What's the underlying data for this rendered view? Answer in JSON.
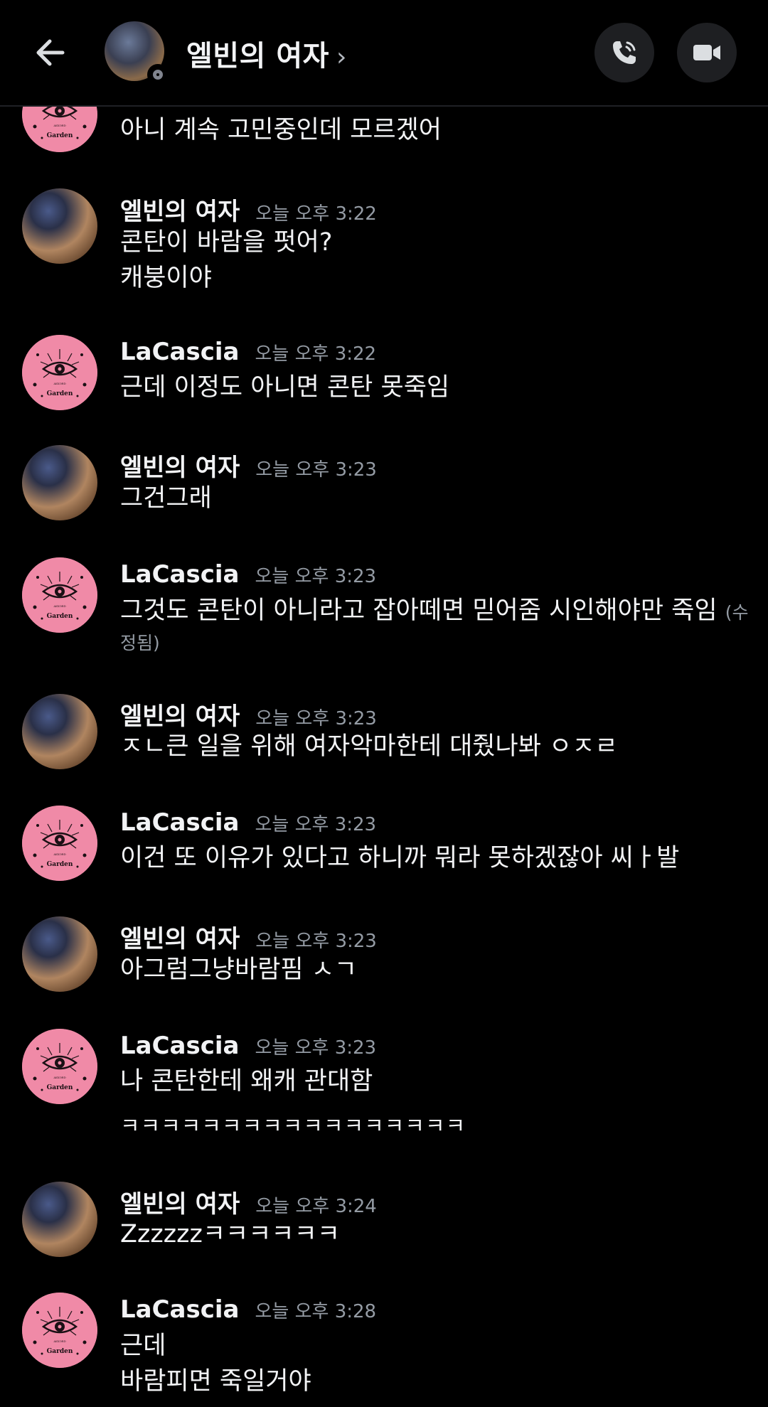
{
  "header": {
    "title": "엘빈의 여자",
    "chevron": "›",
    "back_icon": "arrow-left-icon",
    "call_icon": "phone-icon",
    "video_icon": "video-camera-icon"
  },
  "messages": [
    {
      "lines": [
        "아니 계속 고민중인데 모르겠어"
      ]
    },
    {
      "author": "엘빈의 여자",
      "time": "오늘 오후 3:22",
      "lines": [
        "콘탄이 바람을 펏어?",
        "캐붕이야"
      ]
    },
    {
      "author": "LaCascia",
      "time": "오늘 오후 3:22",
      "lines": [
        "근데 이정도 아니면 콘탄 못죽임"
      ]
    },
    {
      "author": "엘빈의 여자",
      "time": "오늘 오후 3:23",
      "lines": [
        "그건그래"
      ]
    },
    {
      "author": "LaCascia",
      "time": "오늘 오후 3:23",
      "lines": [
        "그것도 콘탄이 아니라고 잡아떼면 믿어줌 시인해야만 죽임",
        "정됨)"
      ],
      "edited": "(수"
    },
    {
      "author": "엘빈의 여자",
      "time": "오늘 오후 3:23",
      "lines": [
        "ㅈㄴ큰 일을 위해 여자악마한테 대줬나봐 ㅇㅈㄹ"
      ]
    },
    {
      "author": "LaCascia",
      "time": "오늘 오후 3:23",
      "lines": [
        "이건 또 이유가 있다고 하니까 뭐라 못하겠잖아 씨ㅏ발"
      ]
    },
    {
      "author": "엘빈의 여자",
      "time": "오늘 오후 3:23",
      "lines": [
        "아그럼그냥바람핌 ㅅㄱ"
      ]
    },
    {
      "author": "LaCascia",
      "time": "오늘 오후 3:23",
      "lines": [
        "나 콘탄한테 왜캐 관대함",
        "ㅋㅋㅋㅋㅋㅋㅋㅋㅋㅋㅋㅋㅋㅋㅋㅋㅋ"
      ]
    },
    {
      "author": "엘빈의 여자",
      "time": "오늘 오후 3:24",
      "lines": [
        "Zzzzzzㅋㅋㅋㅋㅋㅋ"
      ]
    },
    {
      "author": "LaCascia",
      "time": "오늘 오후 3:28",
      "lines": [
        "근데",
        "바람피면 죽일거야"
      ]
    }
  ],
  "avatar_text": "Garden",
  "colors": {
    "background": "#000000",
    "pink_avatar": "#f08aa7",
    "text": "#f2f3f5",
    "muted": "#949ba4"
  }
}
